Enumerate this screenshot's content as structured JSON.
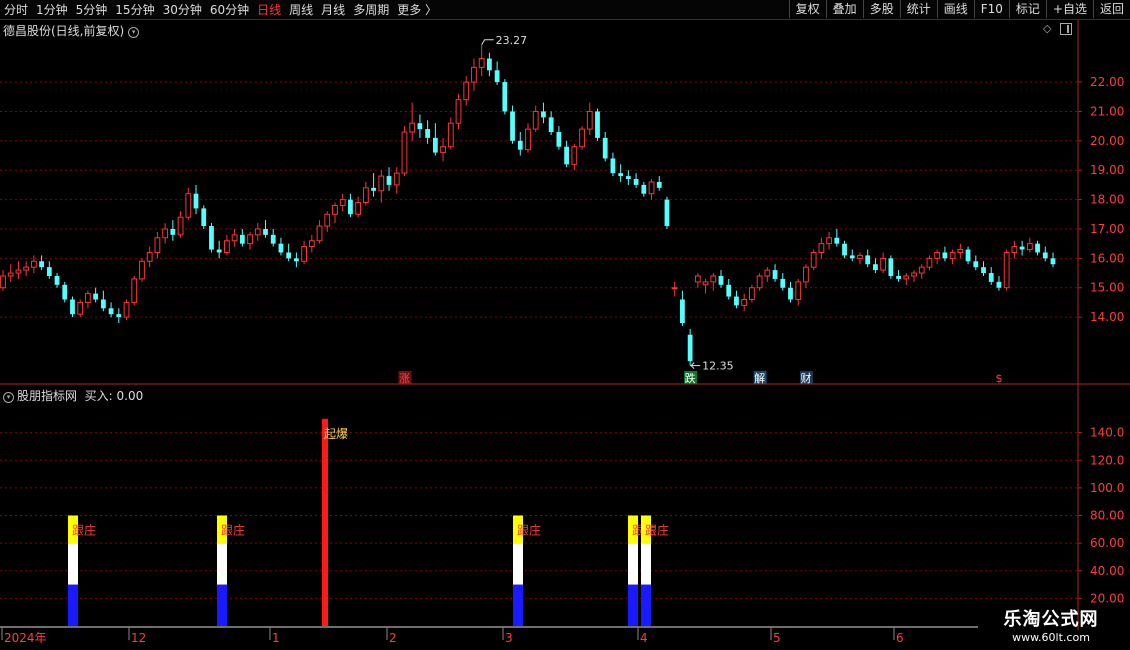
{
  "toolbar": {
    "periods": [
      {
        "label": "分时",
        "active": false
      },
      {
        "label": "1分钟",
        "active": false
      },
      {
        "label": "5分钟",
        "active": false
      },
      {
        "label": "15分钟",
        "active": false
      },
      {
        "label": "30分钟",
        "active": false
      },
      {
        "label": "60分钟",
        "active": false
      },
      {
        "label": "日线",
        "active": true
      },
      {
        "label": "周线",
        "active": false
      },
      {
        "label": "月线",
        "active": false
      },
      {
        "label": "多周期",
        "active": false
      },
      {
        "label": "更多 〉",
        "active": false
      }
    ],
    "actions": [
      "复权",
      "叠加",
      "多股",
      "统计",
      "画线",
      "F10",
      "标记",
      "+自选",
      "返回"
    ]
  },
  "main_panel": {
    "title": "德昌股份(日线,前复权)",
    "icons": [
      "diamond-icon",
      "square-icon"
    ],
    "high_label": "23.27",
    "low_label": "12.35",
    "markers": [
      {
        "text": "涨",
        "color": "#ff4444",
        "bg": "#6a1010"
      },
      {
        "text": "跌",
        "color": "#ffffff",
        "bg": "#0a7a2a"
      },
      {
        "text": "解",
        "color": "#ffffff",
        "bg": "#1a4a6a"
      },
      {
        "text": "财",
        "color": "#ffffff",
        "bg": "#1a3a5a"
      },
      {
        "text": "$",
        "color": "#ff4444",
        "bg": "#000000"
      }
    ]
  },
  "indicator_panel": {
    "title": "股朋指标网",
    "value_label": "买入: 0.00",
    "signals": [
      "跟庄",
      "跟庄",
      "起爆",
      "跟庄",
      "跟庄",
      "跟庄"
    ]
  },
  "x_axis": {
    "labels": [
      "2024年",
      "12",
      "1",
      "2",
      "3",
      "4",
      "5",
      "6"
    ]
  },
  "watermark": {
    "title": "乐淘公式网",
    "url": "www.60lt.com"
  },
  "colors": {
    "up": "#ff3232",
    "down": "#54ffff",
    "grid": "#8b0000",
    "axis": "#b22222",
    "bar_red": "#ff1a1a",
    "bar_blue": "#1a1aff",
    "bar_white": "#ffffff",
    "bar_yellow": "#ffff00"
  },
  "chart_data": [
    {
      "type": "candlestick",
      "title": "德昌股份(日线,前复权)",
      "y_ticks": [
        14.0,
        15.0,
        16.0,
        17.0,
        18.0,
        19.0,
        20.0,
        21.0,
        22.0
      ],
      "ylim": [
        12.2,
        23.5
      ],
      "ohlc": [
        [
          15.0,
          15.6,
          14.9,
          15.4
        ],
        [
          15.4,
          15.8,
          15.2,
          15.5
        ],
        [
          15.5,
          15.9,
          15.3,
          15.6
        ],
        [
          15.6,
          15.9,
          15.4,
          15.7
        ],
        [
          15.7,
          16.1,
          15.5,
          15.9
        ],
        [
          15.9,
          16.1,
          15.6,
          15.7
        ],
        [
          15.7,
          15.9,
          15.3,
          15.4
        ],
        [
          15.4,
          15.5,
          15.0,
          15.1
        ],
        [
          15.1,
          15.2,
          14.5,
          14.6
        ],
        [
          14.6,
          14.7,
          14.0,
          14.1
        ],
        [
          14.1,
          14.6,
          14.0,
          14.5
        ],
        [
          14.5,
          14.9,
          14.3,
          14.8
        ],
        [
          14.8,
          15.0,
          14.5,
          14.6
        ],
        [
          14.6,
          14.9,
          14.2,
          14.3
        ],
        [
          14.3,
          14.5,
          14.0,
          14.1
        ],
        [
          14.1,
          14.3,
          13.8,
          14.0
        ],
        [
          14.0,
          14.6,
          13.9,
          14.5
        ],
        [
          14.5,
          15.4,
          14.4,
          15.3
        ],
        [
          15.3,
          16.0,
          15.2,
          15.9
        ],
        [
          15.9,
          16.4,
          15.7,
          16.2
        ],
        [
          16.2,
          16.9,
          16.0,
          16.7
        ],
        [
          16.7,
          17.2,
          16.5,
          17.0
        ],
        [
          17.0,
          17.3,
          16.6,
          16.8
        ],
        [
          16.8,
          17.6,
          16.7,
          17.4
        ],
        [
          17.4,
          18.4,
          17.3,
          18.2
        ],
        [
          18.2,
          18.5,
          17.5,
          17.7
        ],
        [
          17.7,
          17.8,
          17.0,
          17.1
        ],
        [
          17.1,
          17.2,
          16.2,
          16.3
        ],
        [
          16.3,
          16.6,
          16.0,
          16.2
        ],
        [
          16.2,
          16.8,
          16.1,
          16.6
        ],
        [
          16.6,
          17.0,
          16.4,
          16.8
        ],
        [
          16.8,
          17.0,
          16.4,
          16.5
        ],
        [
          16.5,
          16.9,
          16.3,
          16.8
        ],
        [
          16.8,
          17.2,
          16.6,
          17.0
        ],
        [
          17.0,
          17.3,
          16.7,
          16.8
        ],
        [
          16.8,
          17.0,
          16.4,
          16.5
        ],
        [
          16.5,
          16.7,
          16.1,
          16.2
        ],
        [
          16.2,
          16.5,
          15.9,
          16.0
        ],
        [
          16.0,
          16.2,
          15.7,
          15.9
        ],
        [
          15.9,
          16.6,
          15.8,
          16.4
        ],
        [
          16.4,
          16.8,
          16.2,
          16.6
        ],
        [
          16.6,
          17.3,
          16.5,
          17.1
        ],
        [
          17.1,
          17.6,
          16.9,
          17.5
        ],
        [
          17.5,
          17.9,
          17.2,
          17.8
        ],
        [
          17.8,
          18.2,
          17.6,
          18.0
        ],
        [
          18.0,
          18.2,
          17.4,
          17.5
        ],
        [
          17.5,
          18.1,
          17.4,
          17.9
        ],
        [
          17.9,
          18.6,
          17.8,
          18.4
        ],
        [
          18.4,
          18.9,
          18.1,
          18.3
        ],
        [
          18.3,
          19.0,
          17.9,
          18.8
        ],
        [
          18.8,
          19.1,
          18.3,
          18.5
        ],
        [
          18.5,
          19.1,
          18.2,
          18.9
        ],
        [
          18.9,
          20.5,
          18.8,
          20.3
        ],
        [
          20.3,
          21.3,
          20.0,
          20.6
        ],
        [
          20.6,
          20.9,
          20.1,
          20.4
        ],
        [
          20.4,
          20.7,
          19.9,
          20.1
        ],
        [
          20.1,
          20.6,
          19.5,
          19.6
        ],
        [
          19.6,
          20.1,
          19.3,
          19.8
        ],
        [
          19.8,
          20.8,
          19.7,
          20.6
        ],
        [
          20.6,
          21.6,
          20.4,
          21.4
        ],
        [
          21.4,
          22.2,
          21.2,
          22.0
        ],
        [
          22.0,
          22.8,
          21.7,
          22.5
        ],
        [
          22.5,
          23.27,
          22.2,
          22.8
        ],
        [
          22.8,
          23.0,
          22.2,
          22.4
        ],
        [
          22.4,
          22.7,
          21.9,
          22.0
        ],
        [
          22.0,
          22.1,
          20.9,
          21.0
        ],
        [
          21.0,
          21.2,
          19.9,
          20.0
        ],
        [
          20.0,
          20.3,
          19.5,
          19.7
        ],
        [
          19.7,
          20.6,
          19.6,
          20.4
        ],
        [
          20.4,
          21.2,
          20.3,
          21.0
        ],
        [
          21.0,
          21.3,
          20.6,
          20.8
        ],
        [
          20.8,
          21.0,
          20.2,
          20.3
        ],
        [
          20.3,
          20.5,
          19.7,
          19.8
        ],
        [
          19.8,
          20.0,
          19.1,
          19.2
        ],
        [
          19.2,
          19.9,
          19.0,
          19.8
        ],
        [
          19.8,
          20.5,
          19.7,
          20.4
        ],
        [
          20.4,
          21.3,
          20.2,
          21.0
        ],
        [
          21.0,
          21.1,
          20.0,
          20.1
        ],
        [
          20.1,
          20.3,
          19.3,
          19.4
        ],
        [
          19.4,
          19.6,
          18.8,
          18.9
        ],
        [
          18.9,
          19.2,
          18.6,
          18.8
        ],
        [
          18.8,
          19.0,
          18.5,
          18.7
        ],
        [
          18.7,
          18.9,
          18.4,
          18.5
        ],
        [
          18.5,
          18.6,
          18.1,
          18.2
        ],
        [
          18.2,
          18.7,
          18.0,
          18.6
        ],
        [
          18.6,
          18.8,
          18.3,
          18.4
        ],
        [
          18.0,
          18.1,
          17.0,
          17.1
        ],
        [
          15.0,
          15.2,
          14.7,
          15.0
        ],
        [
          14.6,
          14.9,
          13.7,
          13.8
        ],
        [
          13.4,
          13.6,
          12.35,
          12.5
        ],
        [
          15.2,
          15.5,
          15.0,
          15.4
        ],
        [
          15.1,
          15.3,
          14.8,
          15.2
        ],
        [
          15.2,
          15.5,
          14.9,
          15.4
        ],
        [
          15.4,
          15.6,
          15.0,
          15.1
        ],
        [
          15.1,
          15.3,
          14.6,
          14.7
        ],
        [
          14.7,
          14.9,
          14.3,
          14.4
        ],
        [
          14.4,
          14.8,
          14.2,
          14.6
        ],
        [
          14.6,
          15.1,
          14.5,
          15.0
        ],
        [
          15.0,
          15.5,
          14.9,
          15.4
        ],
        [
          15.4,
          15.7,
          15.2,
          15.6
        ],
        [
          15.6,
          15.8,
          15.2,
          15.3
        ],
        [
          15.3,
          15.5,
          14.9,
          15.0
        ],
        [
          15.0,
          15.2,
          14.5,
          14.6
        ],
        [
          14.6,
          15.3,
          14.4,
          15.2
        ],
        [
          15.2,
          15.8,
          15.0,
          15.7
        ],
        [
          15.7,
          16.3,
          15.6,
          16.2
        ],
        [
          16.2,
          16.7,
          16.0,
          16.5
        ],
        [
          16.5,
          16.9,
          16.3,
          16.7
        ],
        [
          16.7,
          17.0,
          16.4,
          16.5
        ],
        [
          16.5,
          16.6,
          16.0,
          16.1
        ],
        [
          16.1,
          16.3,
          15.9,
          16.0
        ],
        [
          16.0,
          16.2,
          15.8,
          16.1
        ],
        [
          16.1,
          16.3,
          15.7,
          15.8
        ],
        [
          15.8,
          16.0,
          15.5,
          15.6
        ],
        [
          15.6,
          16.2,
          15.5,
          16.0
        ],
        [
          16.0,
          16.1,
          15.3,
          15.4
        ],
        [
          15.4,
          15.6,
          15.2,
          15.3
        ],
        [
          15.3,
          15.5,
          15.1,
          15.4
        ],
        [
          15.4,
          15.6,
          15.2,
          15.5
        ],
        [
          15.5,
          15.8,
          15.3,
          15.7
        ],
        [
          15.7,
          16.1,
          15.6,
          16.0
        ],
        [
          16.0,
          16.3,
          15.8,
          16.2
        ],
        [
          16.2,
          16.4,
          15.9,
          16.0
        ],
        [
          16.0,
          16.3,
          15.8,
          16.2
        ],
        [
          16.2,
          16.5,
          16.0,
          16.3
        ],
        [
          16.3,
          16.4,
          15.8,
          15.9
        ],
        [
          15.9,
          16.1,
          15.6,
          15.7
        ],
        [
          15.7,
          15.9,
          15.4,
          15.5
        ],
        [
          15.5,
          15.7,
          15.1,
          15.2
        ],
        [
          15.2,
          15.4,
          14.9,
          15.0
        ],
        [
          15.0,
          16.3,
          14.9,
          16.2
        ],
        [
          16.2,
          16.6,
          16.0,
          16.4
        ],
        [
          16.4,
          16.6,
          16.1,
          16.3
        ],
        [
          16.3,
          16.7,
          16.2,
          16.5
        ],
        [
          16.5,
          16.6,
          16.1,
          16.2
        ],
        [
          16.2,
          16.4,
          15.9,
          16.0
        ],
        [
          16.0,
          16.2,
          15.7,
          15.8
        ]
      ],
      "events": [
        {
          "label": "23.27",
          "value": 23.27
        },
        {
          "label": "12.35",
          "value": 12.35
        }
      ]
    },
    {
      "type": "bar",
      "title": "股朋指标网",
      "y_ticks": [
        20.0,
        40.0,
        60.0,
        80.0,
        100.0,
        120.0,
        140.0
      ],
      "ylim": [
        0,
        160
      ],
      "signals": [
        {
          "segments": [
            {
              "color": "blue",
              "to": 30
            },
            {
              "color": "white",
              "to": 60
            },
            {
              "color": "yellow",
              "to": 80
            }
          ],
          "label": "跟庄"
        },
        {
          "segments": [
            {
              "color": "blue",
              "to": 30
            },
            {
              "color": "white",
              "to": 60
            },
            {
              "color": "yellow",
              "to": 80
            }
          ],
          "label": "跟庄"
        },
        {
          "segments": [
            {
              "color": "red",
              "to": 150
            }
          ],
          "label": "起爆"
        },
        {
          "segments": [
            {
              "color": "blue",
              "to": 30
            },
            {
              "color": "white",
              "to": 60
            },
            {
              "color": "yellow",
              "to": 80
            }
          ],
          "label": "跟庄"
        },
        {
          "segments": [
            {
              "color": "blue",
              "to": 30
            },
            {
              "color": "white",
              "to": 60
            },
            {
              "color": "yellow",
              "to": 80
            }
          ],
          "label": "跟庄"
        },
        {
          "segments": [
            {
              "color": "blue",
              "to": 30
            },
            {
              "color": "white",
              "to": 60
            },
            {
              "color": "yellow",
              "to": 80
            }
          ],
          "label": "跟庄"
        }
      ]
    }
  ]
}
